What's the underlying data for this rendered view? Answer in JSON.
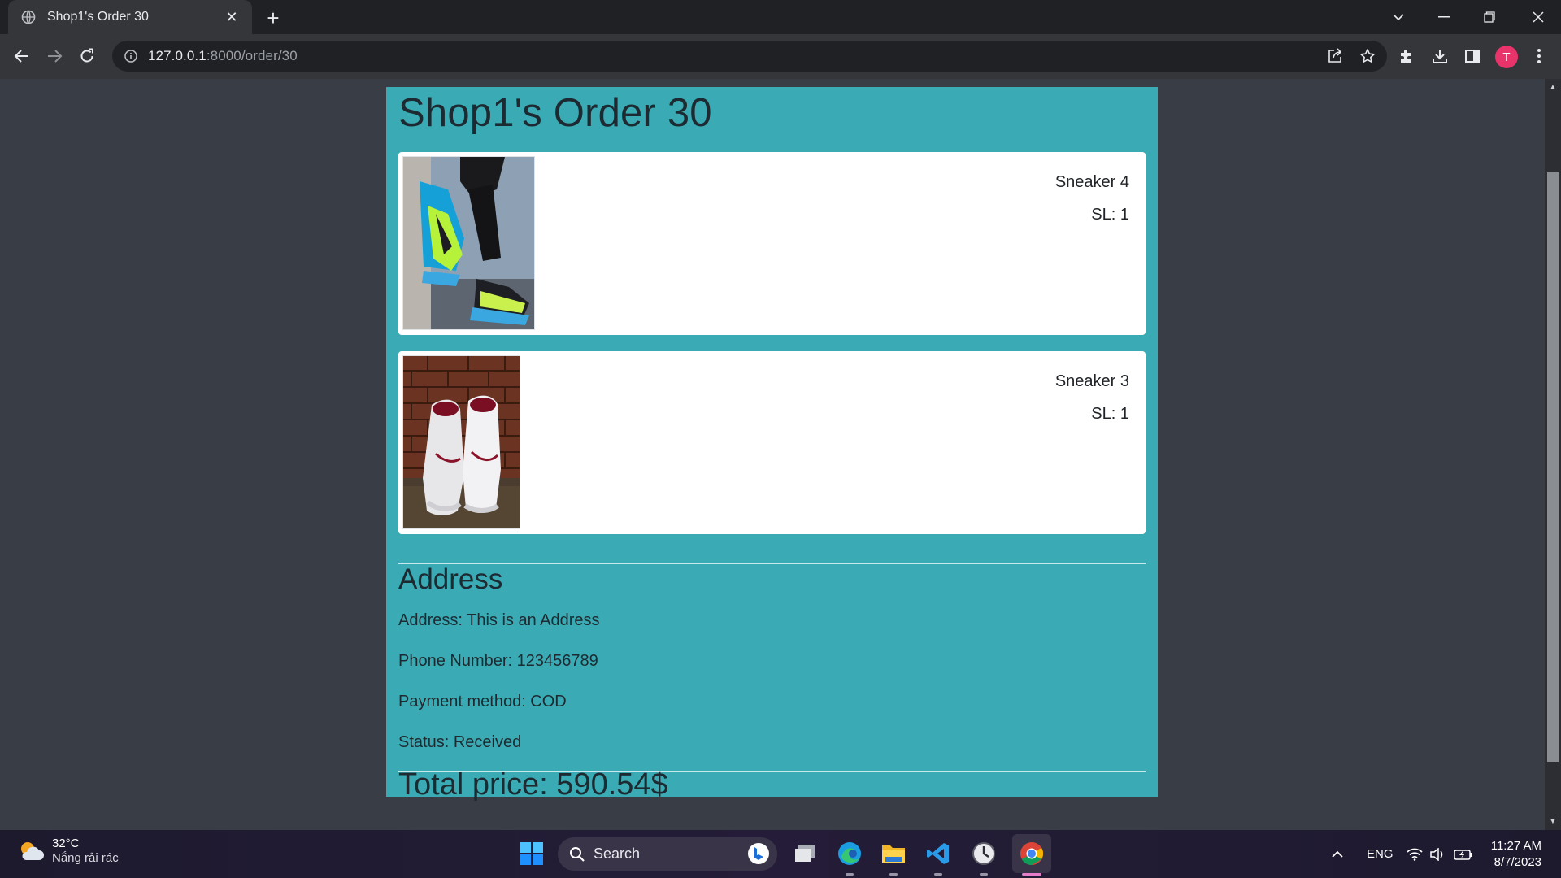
{
  "browser": {
    "tab_title": "Shop1's Order 30",
    "url_host": "127.0.0.1",
    "url_path": ":8000/order/30",
    "profile_initial": "T",
    "profile_color": "#e8336b"
  },
  "page": {
    "title": "Shop1's Order 30",
    "background": "#3aabb4",
    "items": [
      {
        "name": "Sneaker 4",
        "qty": "SL: 1",
        "image": "sneaker-on-feet-photo"
      },
      {
        "name": "Sneaker 3",
        "qty": "SL: 1",
        "image": "white-sneakers-brick-wall-photo"
      }
    ],
    "address_heading": "Address",
    "address": "Address: This is an Address",
    "phone": "Phone Number: 123456789",
    "payment": "Payment method: COD",
    "status": "Status: Received",
    "total": "Total price: 590.54$"
  },
  "taskbar": {
    "weather_temp": "32°C",
    "weather_desc": "Nắng rải rác",
    "search_placeholder": "Search",
    "language": "ENG",
    "time": "11:27 AM",
    "date": "8/7/2023"
  }
}
